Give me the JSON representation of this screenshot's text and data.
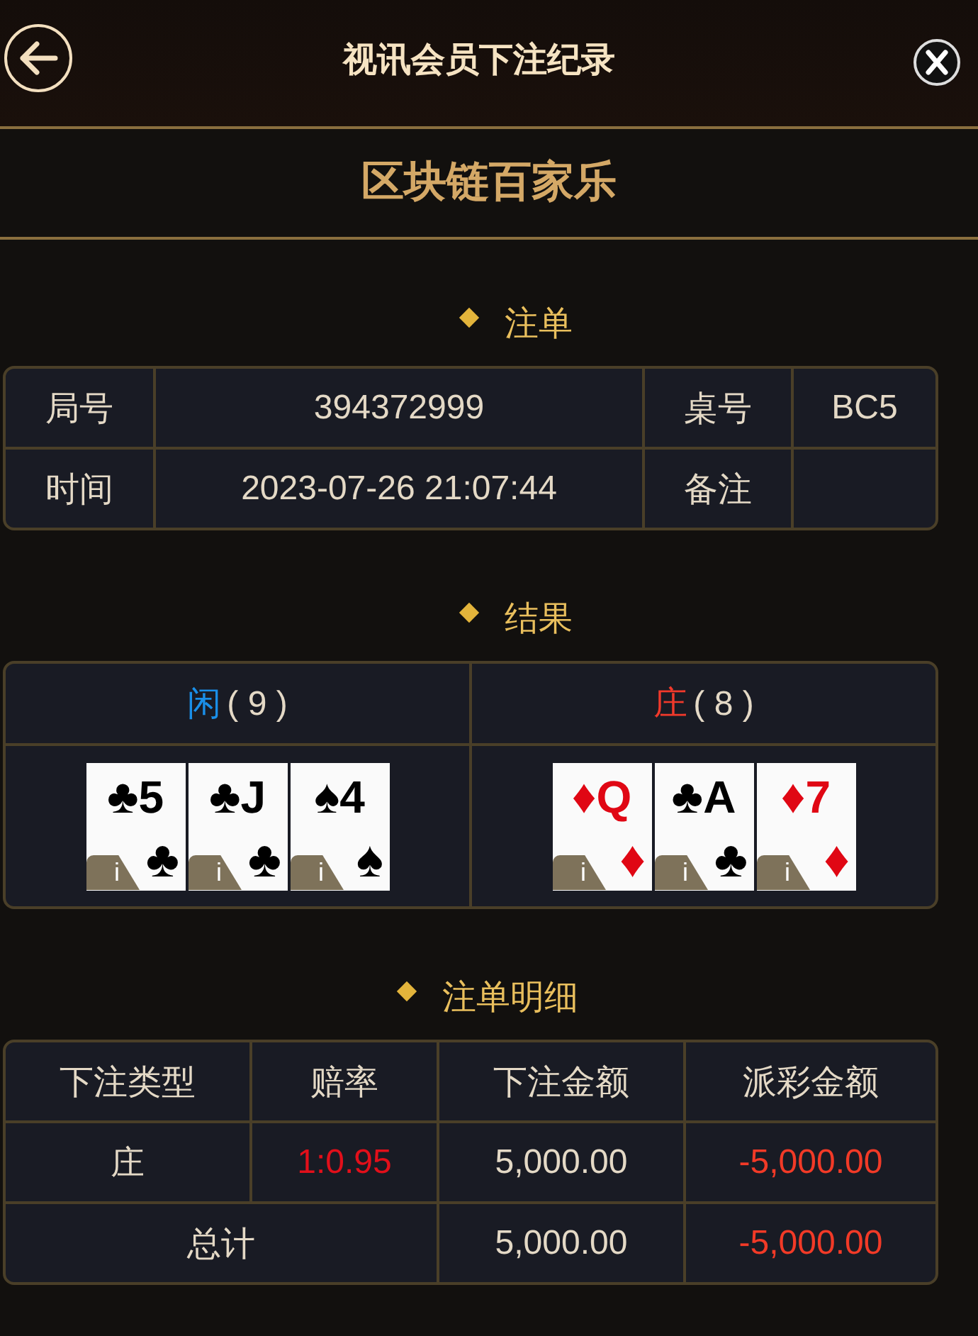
{
  "header": {
    "title": "视讯会员下注纪录"
  },
  "game_title": "区块链百家乐",
  "bet_section": {
    "heading": "注单",
    "rows": [
      {
        "label_1": "局号",
        "value_1": "394372999",
        "label_2": "桌号",
        "value_2": "BC5"
      },
      {
        "label_1": "时间",
        "value_1": "2023-07-26 21:07:44",
        "label_2": "备注"
      }
    ]
  },
  "result_section": {
    "heading": "结果",
    "hands": [
      {
        "side": "闲",
        "score": "( 9 )",
        "color": "#1a8fe8",
        "cards": [
          {
            "rank": "5",
            "suit": "♣",
            "red": false,
            "info": "i"
          },
          {
            "rank": "J",
            "suit": "♣",
            "red": false,
            "info": "i"
          },
          {
            "rank": "4",
            "suit": "♠",
            "red": false,
            "info": "i"
          }
        ]
      },
      {
        "side": "庄",
        "score": "( 8 )",
        "color": "#f0392b",
        "cards": [
          {
            "rank": "Q",
            "suit": "♦",
            "red": true,
            "info": "i"
          },
          {
            "rank": "A",
            "suit": "♣",
            "red": false,
            "info": "i"
          },
          {
            "rank": "7",
            "suit": "♦",
            "red": true,
            "info": "i"
          }
        ]
      }
    ]
  },
  "detail_section": {
    "heading": "注单明细",
    "columns": [
      "下注类型",
      "赔率",
      "下注金额",
      "派彩金额"
    ],
    "rows": [
      {
        "bet_type": "庄",
        "odds": "1:0.95",
        "bet_amount": "5,000.00",
        "payout": "-5,000.00"
      }
    ],
    "total": {
      "label": "总计",
      "bet_amount": "5,000.00",
      "payout": "-5,000.00"
    }
  }
}
